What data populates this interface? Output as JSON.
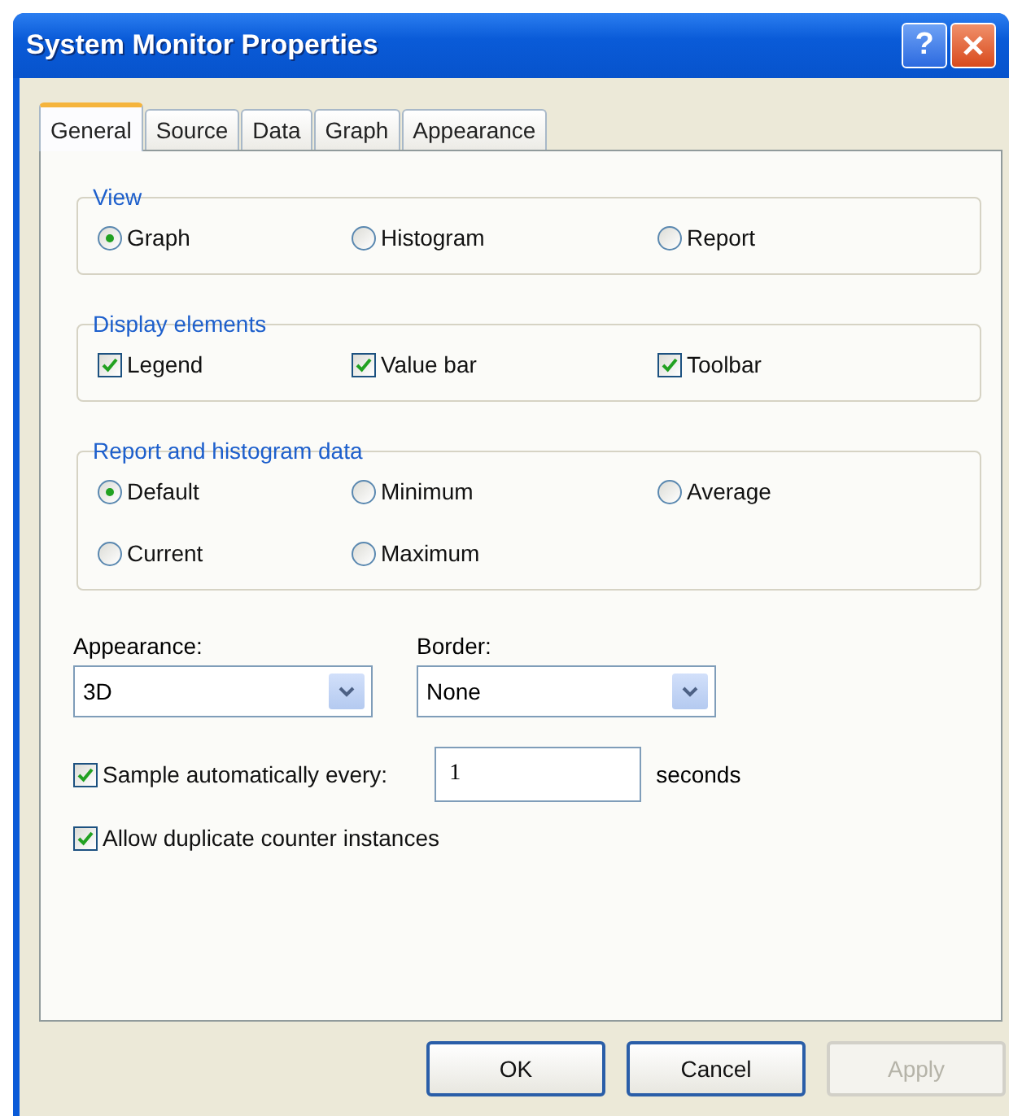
{
  "window": {
    "title": "System Monitor Properties",
    "help": "?"
  },
  "tabs": [
    {
      "label": "General",
      "selected": true
    },
    {
      "label": "Source",
      "selected": false
    },
    {
      "label": "Data",
      "selected": false
    },
    {
      "label": "Graph",
      "selected": false
    },
    {
      "label": "Appearance",
      "selected": false
    }
  ],
  "groups": [
    {
      "title": "View",
      "kind": "radio",
      "items": [
        {
          "label": "Graph",
          "selected": true
        },
        {
          "label": "Histogram",
          "selected": false
        },
        {
          "label": "Report",
          "selected": false
        }
      ]
    },
    {
      "title": "Display elements",
      "kind": "check",
      "items": [
        {
          "label": "Legend",
          "checked": true
        },
        {
          "label": "Value bar",
          "checked": true
        },
        {
          "label": "Toolbar",
          "checked": true
        }
      ]
    },
    {
      "title": "Report and histogram data",
      "kind": "radio",
      "items": [
        {
          "label": "Default",
          "selected": true
        },
        {
          "label": "Minimum",
          "selected": false
        },
        {
          "label": "Average",
          "selected": false
        },
        {
          "label": "Current",
          "selected": false
        },
        {
          "label": "Maximum",
          "selected": false
        }
      ]
    }
  ],
  "dropdowns": [
    {
      "label": "Appearance:",
      "value": "3D"
    },
    {
      "label": "Border:",
      "value": "None"
    }
  ],
  "sample": {
    "label": "Sample automatically every:",
    "checked": true,
    "value": "1",
    "unit": "seconds"
  },
  "allow_duplicates": {
    "label": "Allow duplicate counter instances",
    "checked": true
  },
  "buttons": [
    {
      "label": "OK",
      "disabled": false
    },
    {
      "label": "Cancel",
      "disabled": false
    },
    {
      "label": "Apply",
      "disabled": true
    }
  ]
}
